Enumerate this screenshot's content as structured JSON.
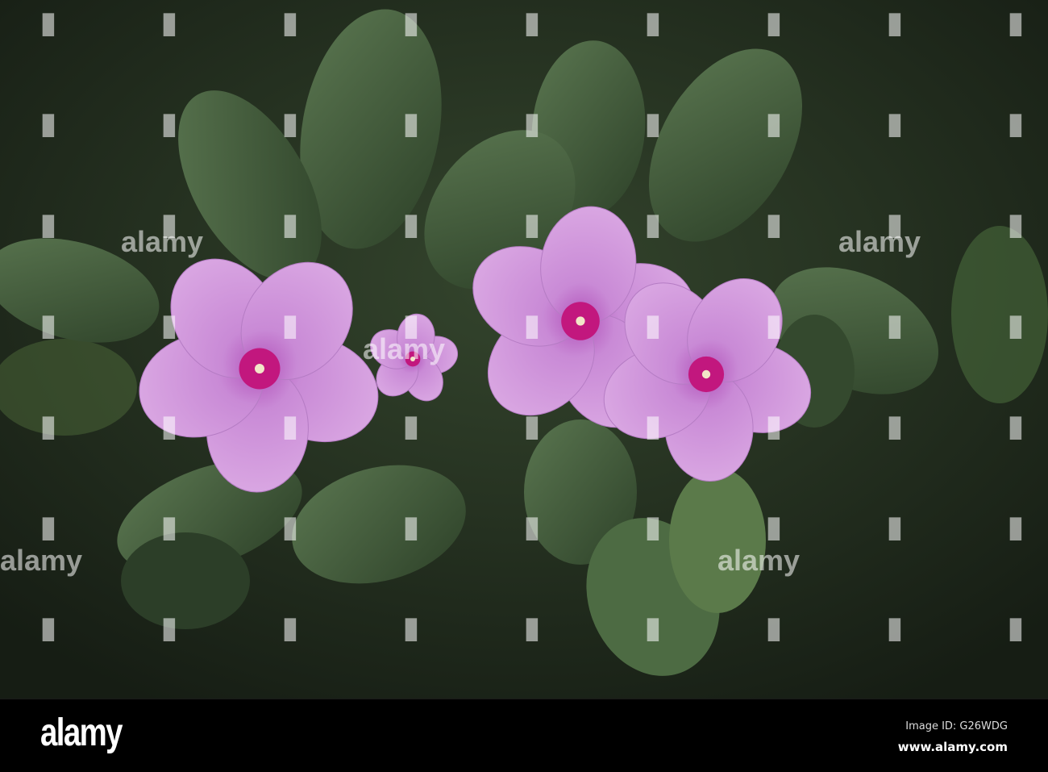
{
  "image": {
    "subject": "pink periwinkle flowers",
    "colors": {
      "background": "#1f2a1c",
      "leaf": "#3e5637",
      "leaf_light": "#5c7a4f",
      "petal": "#cc8ed8",
      "petal_light": "#dcaae4",
      "eye": "#c2177e"
    }
  },
  "watermark": {
    "text": "alamy"
  },
  "footer": {
    "brand": "alamy",
    "image_id": "Image ID: G26WDG",
    "site": "www.alamy.com"
  }
}
